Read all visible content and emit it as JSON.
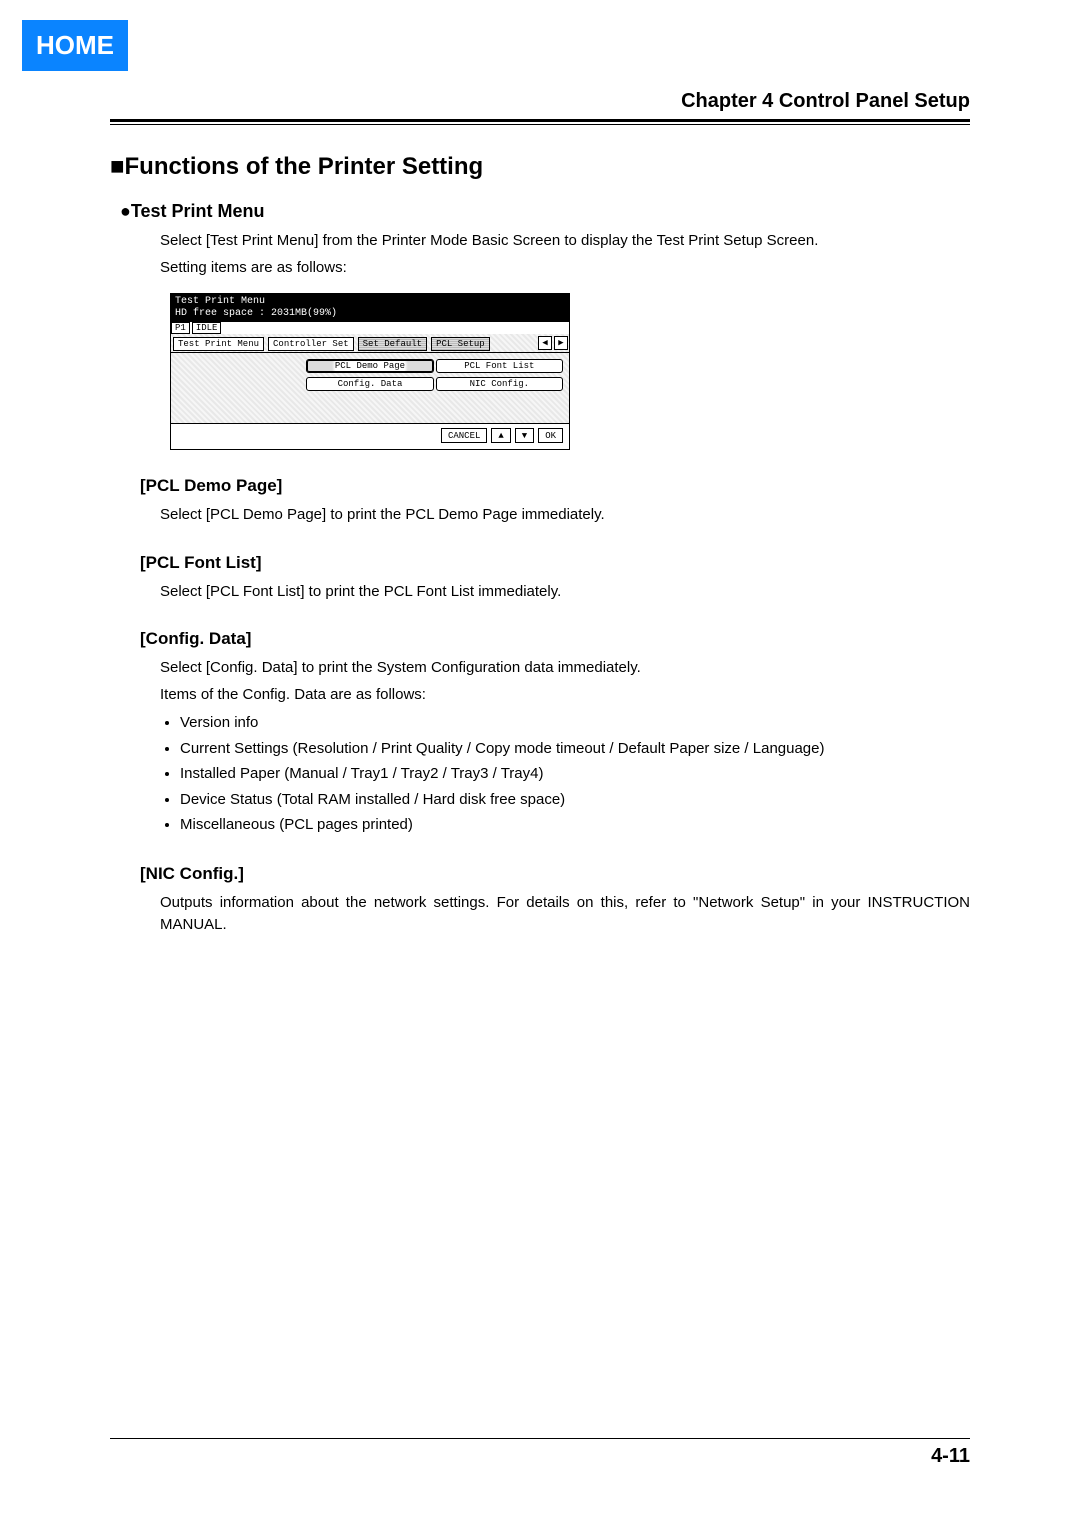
{
  "home_button": "HOME",
  "chapter_title": "Chapter 4 Control Panel Setup",
  "page_number": "4-11",
  "main_heading": "■Functions of the Printer Setting",
  "sub_heading": "●Test Print Menu",
  "intro_p1": "Select [Test Print Menu] from the Printer Mode Basic Screen to display the Test Print Setup Screen.",
  "intro_p2": "Setting items are as follows:",
  "lcd": {
    "title": "Test Print Menu",
    "hd_line": "HD free space : 2031MB(99%)",
    "status_left": "P1",
    "status_right": "IDLE",
    "tabs": [
      "Test Print Menu",
      "Controller Set",
      "Set Default",
      "PCL Setup"
    ],
    "buttons_col1": [
      "PCL Demo Page",
      "Config. Data"
    ],
    "buttons_col2": [
      "PCL Font List",
      "NIC Config."
    ],
    "footer": {
      "cancel": "CANCEL",
      "up": "▲",
      "down": "▼",
      "ok": "OK"
    }
  },
  "items": {
    "pcl_demo": {
      "h": "[PCL Demo Page]",
      "p": "Select [PCL Demo Page] to print the PCL Demo Page immediately."
    },
    "pcl_font": {
      "h": "[PCL Font List]",
      "p": "Select [PCL Font List] to print the PCL Font List immediately."
    },
    "config": {
      "h": "[Config. Data]",
      "p1": "Select [Config. Data] to print the System Configuration data immediately.",
      "p2": "Items of the Config. Data are as follows:",
      "list": [
        "Version info",
        "Current Settings (Resolution / Print Quality / Copy mode timeout / Default Paper size / Language)",
        "Installed Paper (Manual / Tray1 / Tray2 / Tray3 / Tray4)",
        "Device Status (Total RAM installed / Hard disk free space)",
        "Miscellaneous (PCL pages printed)"
      ]
    },
    "nic": {
      "h": "[NIC Config.]",
      "p": "Outputs information about the network settings. For details on this, refer to \"Network Setup\" in your INSTRUCTION MANUAL."
    }
  }
}
